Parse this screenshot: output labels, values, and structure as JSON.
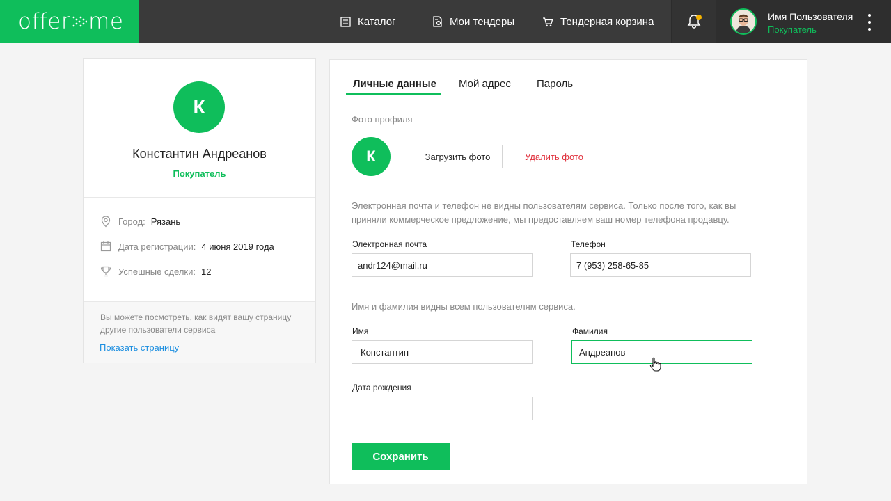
{
  "header": {
    "logo_left": "offer",
    "logo_right": "me",
    "nav": [
      {
        "label": "Каталог",
        "icon": "catalog-icon"
      },
      {
        "label": "Мои тендеры",
        "icon": "tenders-icon"
      },
      {
        "label": "Тендерная корзина",
        "icon": "cart-icon"
      }
    ],
    "notifications_icon": "bell-icon",
    "user": {
      "name": "Имя Пользователя",
      "role": "Покупатель"
    }
  },
  "profile": {
    "initial": "К",
    "full_name": "Константин Андреанов",
    "role": "Покупатель",
    "city_label": "Город:",
    "city": "Рязань",
    "reg_label": "Дата регистрации:",
    "reg_date": "4 июня 2019 года",
    "deals_label": "Успешные сделки:",
    "deals": "12",
    "footer_note": "Вы можете посмотреть, как видят вашу страницу другие пользователи сервиса",
    "footer_link": "Показать страницу"
  },
  "tabs": [
    {
      "label": "Личные данные",
      "active": true
    },
    {
      "label": "Мой адрес",
      "active": false
    },
    {
      "label": "Пароль",
      "active": false
    }
  ],
  "form": {
    "photo_label": "Фото профиля",
    "avatar_initial": "К",
    "upload_button": "Загрузить фото",
    "delete_button": "Удалить фото",
    "contact_note": "Электронная почта и телефон не видны пользователям сервиса. Только после того, как вы приняли коммерческое предложение, мы предоставляем ваш номер телефона продавцу.",
    "email_label": "Электронная почта",
    "email_value": "andr124@mail.ru",
    "phone_label": "Телефон",
    "phone_value": "7 (953) 258-65-85",
    "name_note": "Имя и фамилия видны всем пользователям сервиса.",
    "first_name_label": "Имя",
    "first_name_value": "Константин",
    "last_name_label": "Фамилия",
    "last_name_value": "Андреанов",
    "birth_label": "Дата рождения",
    "birth_value": "",
    "save_button": "Сохранить"
  },
  "colors": {
    "brand_green": "#0fbe5b",
    "header_bg": "#3a3a3a",
    "link_blue": "#1b8ee0",
    "danger_red": "#e0303c",
    "notification_dot": "#f5b300"
  }
}
